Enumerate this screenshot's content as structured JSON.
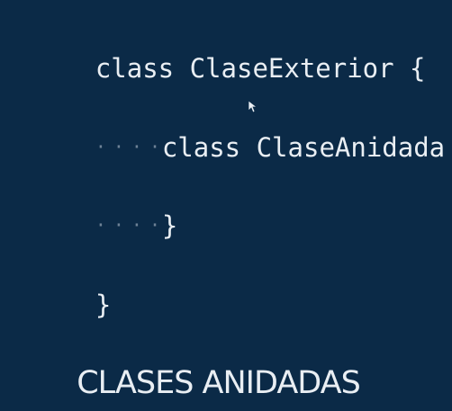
{
  "code": {
    "line1": "class ClaseExterior {",
    "line2_indent": "····",
    "line2": "class ClaseAnidada {",
    "line3_indent": "····",
    "line3": "}",
    "line4": "}"
  },
  "caption": "CLASES ANIDADAS",
  "colors": {
    "background": "#0b2a47",
    "text": "#e9eef3",
    "indent_dots": "#6e8296"
  },
  "icons": {
    "cursor": "mouse-pointer-icon"
  }
}
